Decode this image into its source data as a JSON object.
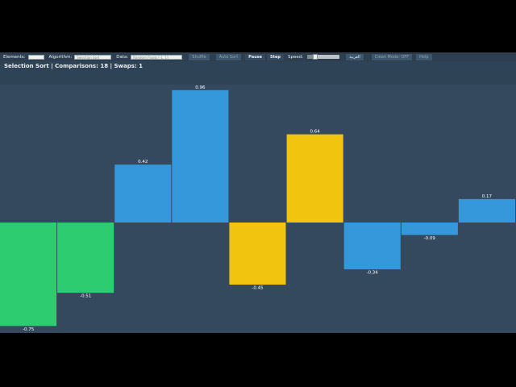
{
  "toolbar": {
    "elements_label": "Elements:",
    "elements_value": "",
    "algorithm_label": "Algorithm:",
    "algorithm_value": "Selection Sort",
    "data_label": "Data:",
    "data_value": "Random Floats [-1, 1]",
    "shuffle_label": "Shuffle",
    "autosort_label": "Auto Sort",
    "pause_label": "Pause",
    "step_label": "Step",
    "speed_label": "Speed:",
    "speed_level": 0.25,
    "arabic_label": "العربية",
    "clean_mode_label": "Clean Mode: OFF",
    "help_label": "Help"
  },
  "status": {
    "text": "Selection Sort  |  Comparisons: 18  |  Swaps: 1"
  },
  "colors": {
    "sorted": "#2ecc71",
    "unsorted": "#3498db",
    "highlighted": "#f1c40f",
    "background": "#34495e"
  },
  "chart_data": {
    "type": "bar",
    "values": [
      -0.75,
      -0.51,
      0.42,
      0.96,
      -0.45,
      0.64,
      -0.34,
      -0.09,
      0.17
    ],
    "labels": [
      "-0.75",
      "-0.51",
      "0.42",
      "0.96",
      "-0.45",
      "0.64",
      "-0.34",
      "-0.09",
      "0.17"
    ],
    "states": [
      "sorted",
      "sorted",
      "unsorted",
      "unsorted",
      "highlighted",
      "highlighted",
      "unsorted",
      "unsorted",
      "unsorted"
    ],
    "ylim": [
      -1,
      1
    ]
  }
}
